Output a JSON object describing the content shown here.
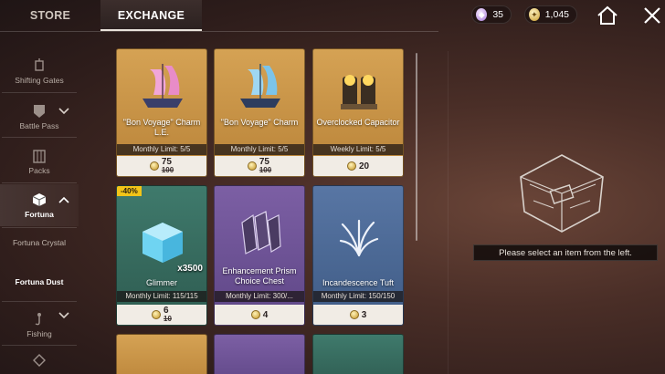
{
  "tabs": [
    {
      "label": "STORE"
    },
    {
      "label": "EXCHANGE"
    }
  ],
  "currencies": [
    {
      "icon": "crystal-icon",
      "value": "35"
    },
    {
      "icon": "fortuna-coin-icon",
      "value": "1,045"
    }
  ],
  "sidebar": {
    "items": [
      {
        "label": "Shifting Gates",
        "icon": "lantern-icon"
      },
      {
        "label": "Battle Pass",
        "icon": "battle-pass-icon"
      },
      {
        "label": "Packs",
        "icon": "packs-icon"
      },
      {
        "label": "Fortuna",
        "icon": "fortuna-cube-icon"
      },
      {
        "label": "Fishing",
        "icon": "fishing-icon"
      }
    ],
    "fortuna_sub": [
      "Fortuna Crystal",
      "Fortuna Dust"
    ]
  },
  "items": [
    {
      "name": "\"Bon Voyage\" Charm L.E.",
      "limit": "Monthly Limit: 5/5",
      "price": "75",
      "old_price": "100",
      "theme": "gold",
      "icon": "pink-ship-icon"
    },
    {
      "name": "\"Bon Voyage\" Charm",
      "limit": "Monthly Limit: 5/5",
      "price": "75",
      "old_price": "100",
      "theme": "gold",
      "icon": "blue-ship-icon"
    },
    {
      "name": "Overclocked Capacitor",
      "limit": "Weekly Limit: 5/5",
      "price": "20",
      "old_price": "",
      "theme": "gold",
      "icon": "capacitor-icon"
    },
    {
      "name": "Glimmer",
      "limit": "Monthly Limit: 115/115",
      "price": "6",
      "old_price": "10",
      "theme": "green",
      "icon": "glimmer-cube-icon",
      "badge": "-40%",
      "quantity": "x3500"
    },
    {
      "name": "Enhancement Prism Choice Chest",
      "limit": "Monthly Limit: 300/...",
      "price": "4",
      "old_price": "",
      "theme": "purple",
      "icon": "prism-chest-icon"
    },
    {
      "name": "Incandescence Tuft",
      "limit": "Monthly Limit: 150/150",
      "price": "3",
      "old_price": "",
      "theme": "blue",
      "icon": "tuft-icon"
    }
  ],
  "detail": {
    "placeholder": "Please select an item from the left.",
    "icon": "ghost-shell-icon"
  }
}
